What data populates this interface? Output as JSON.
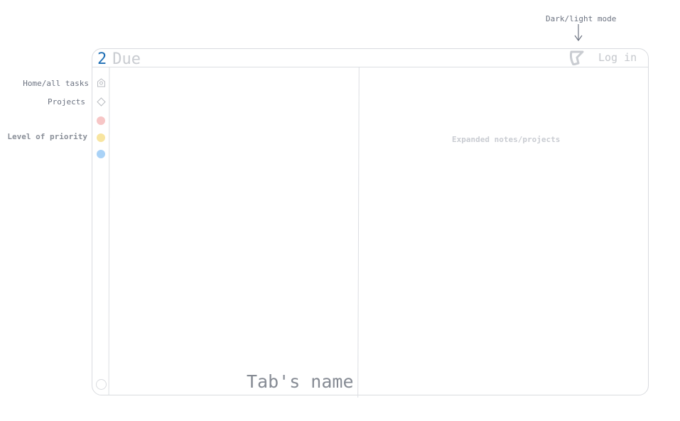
{
  "annotations": {
    "theme_toggle": "Dark/light mode",
    "home": "Home/all tasks",
    "projects": "Projects",
    "priority": "Level of priority"
  },
  "header": {
    "logo_number": "2",
    "logo_text": "Due",
    "login_label": "Log in",
    "theme_icon": "moon-icon"
  },
  "sidebar": {
    "items": [
      {
        "name": "home",
        "icon": "home-icon"
      },
      {
        "name": "projects",
        "icon": "diamond-icon"
      }
    ],
    "priorities": [
      {
        "level": "high",
        "color": "#f7c6c6"
      },
      {
        "level": "medium",
        "color": "#f8e5a0"
      },
      {
        "level": "low",
        "color": "#a9d2f7"
      }
    ]
  },
  "main": {
    "tab_name": "Tab's name",
    "detail_placeholder": "Expanded notes/projects"
  },
  "colors": {
    "accent": "#1f6fb5",
    "border": "#d9dbdf"
  }
}
